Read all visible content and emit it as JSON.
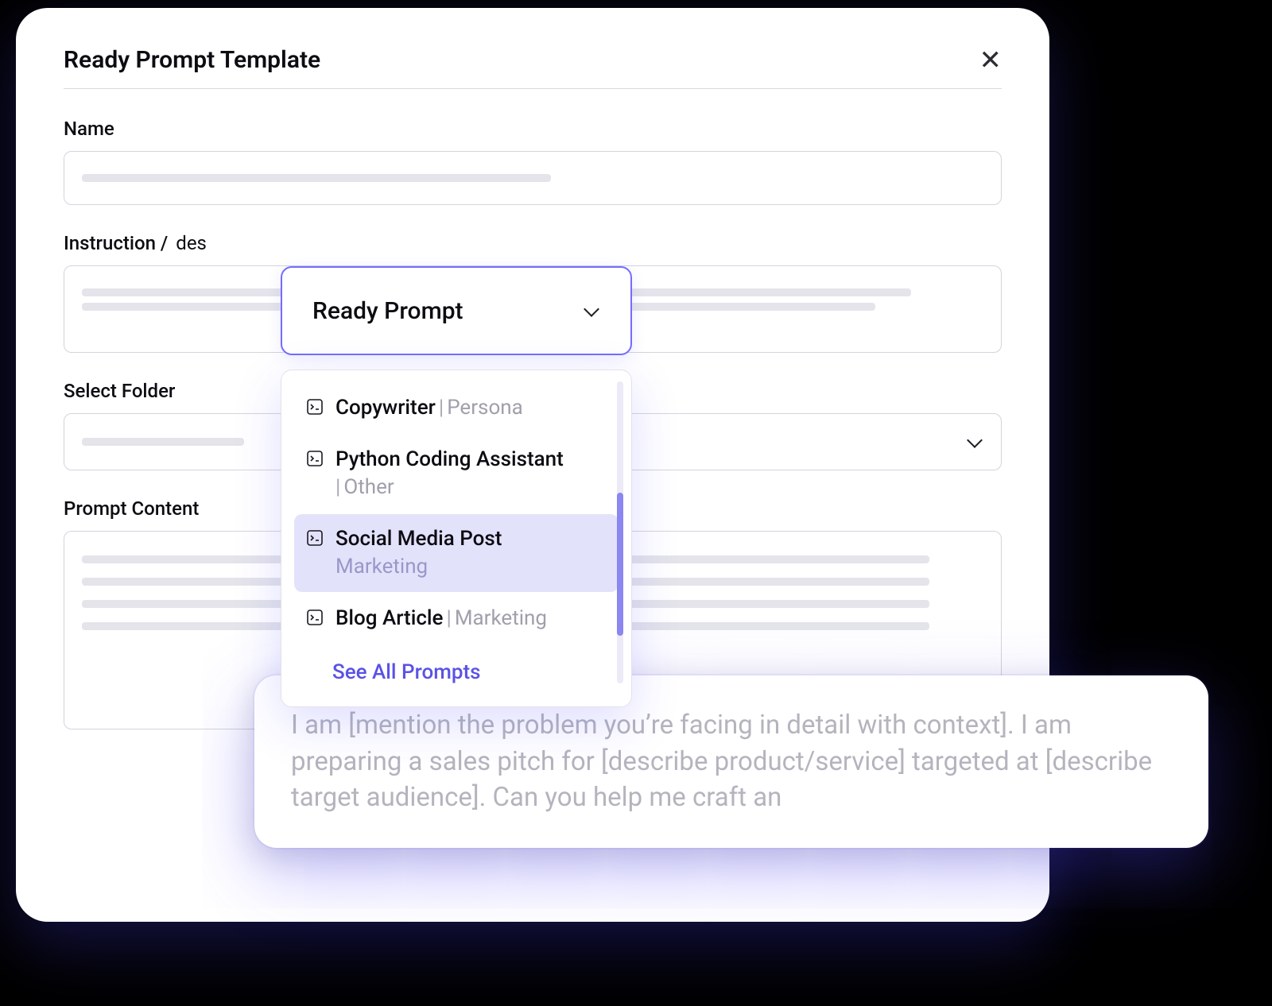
{
  "modal": {
    "title": "Ready Prompt Template",
    "labels": {
      "name": "Name",
      "instruction_prefix": "Instruction /",
      "instruction_cut": "des",
      "folder": "Select Folder",
      "content": "Prompt  Content"
    }
  },
  "dropdown": {
    "toggle_label": "Ready Prompt",
    "items": [
      {
        "title": "Copywriter",
        "category": "Persona",
        "selected": false,
        "inline": true
      },
      {
        "title": "Python Coding Assistant",
        "category": "Other",
        "selected": false,
        "inline": false
      },
      {
        "title": "Social Media Post",
        "category": "Marketing",
        "selected": true,
        "inline": false
      },
      {
        "title": "Blog Article",
        "category": "Marketing",
        "selected": false,
        "inline": true
      }
    ],
    "see_all": "See All Prompts"
  },
  "preview": {
    "text": "I am [mention the problem you’re facing in detail with context]. I am  preparing a sales pitch for [describe product/service] targeted at [describe target audience].  Can you help me craft an"
  }
}
